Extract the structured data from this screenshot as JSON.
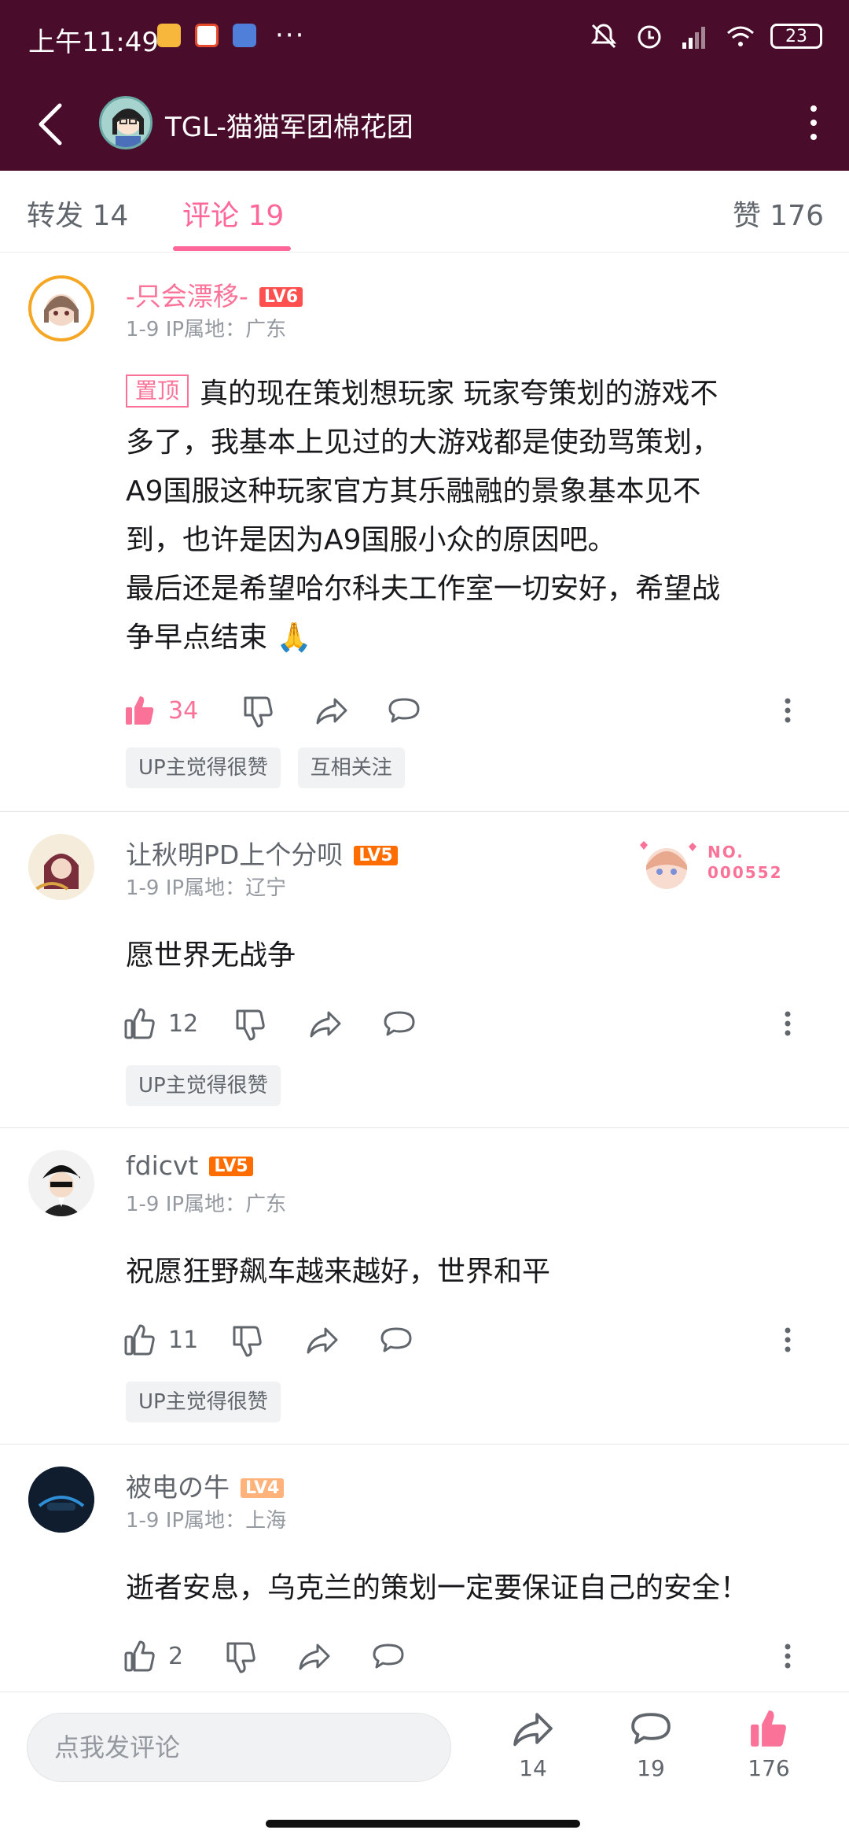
{
  "status_bar": {
    "time": "上午11:49",
    "more": "···",
    "battery": "23"
  },
  "header": {
    "title": "TGL-猫猫军团棉花团"
  },
  "tabs": {
    "forward": "转发 14",
    "comments": "评论 19",
    "likes": "赞 176"
  },
  "comments": [
    {
      "username": "-只会漂移-",
      "level": "LV6",
      "meta": "1-9  IP属地：广东",
      "pinned_label": "置顶",
      "text_lines": [
        "真的现在策划想玩家 玩家夸策划的游戏不",
        "多了，我基本上见过的大游戏都是使劲骂策划，",
        "A9国服这种玩家官方其乐融融的景象基本见不",
        "到，也许是因为A9国服小众的原因吧。",
        "最后还是希望哈尔科夫工作室一切安好，希望战",
        "争早点结束 🙏"
      ],
      "likes": "34",
      "tags": [
        "UP主觉得很赞",
        "互相关注"
      ]
    },
    {
      "username": "让秋明PD上个分呗",
      "level": "LV5",
      "meta": "1-9  IP属地：辽宁",
      "badge_line1": "NO.",
      "badge_line2": "000552",
      "text": "愿世界无战争",
      "likes": "12",
      "tags": [
        "UP主觉得很赞"
      ]
    },
    {
      "username": "fdicvt",
      "level": "LV5",
      "meta": "1-9  IP属地：广东",
      "text": "祝愿狂野飙车越来越好，世界和平",
      "likes": "11",
      "tags": [
        "UP主觉得很赞"
      ]
    },
    {
      "username": "被电の牛",
      "level": "LV4",
      "meta": "1-9  IP属地：上海",
      "text": "逝者安息，乌克兰的策划一定要保证自己的安全！",
      "likes": "2",
      "tags": []
    }
  ],
  "bottom_bar": {
    "input_placeholder": "点我发评论",
    "forward_count": "14",
    "comment_count": "19",
    "like_count": "176"
  },
  "colors": {
    "header_bg": "#4a0c2b",
    "accent_pink": "#fb7299",
    "lv6": "#ff4f4f",
    "lv5": "#ff6c00",
    "lv4": "#ffb27a"
  }
}
